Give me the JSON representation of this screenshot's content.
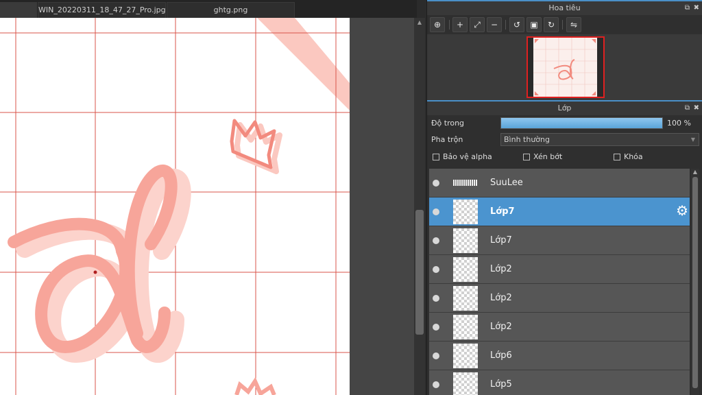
{
  "tabs": [
    {
      "label": "WIN_20220311_18_47_27_Pro.jpg"
    },
    {
      "label": "ghtg.png"
    }
  ],
  "navigator": {
    "title": "Hoa tiêu",
    "tools": [
      "zoom-actual-icon",
      "zoom-in-icon",
      "fit-screen-icon",
      "zoom-out-icon",
      "rotate-left-icon",
      "fullscreen-icon",
      "rotate-right-icon",
      "flip-icon"
    ]
  },
  "layers_panel": {
    "title": "Lớp",
    "opacity_label": "Độ trong",
    "opacity_value": "100 %",
    "opacity_fraction": 1.0,
    "blend_label": "Pha trộn",
    "blend_value": "Bình thường",
    "protect_alpha": "Bảo vệ alpha",
    "clipping": "Xén bớt",
    "lock": "Khóa",
    "layers": [
      {
        "name": "SuuLee",
        "selected": false,
        "text_thumb": true
      },
      {
        "name": "Lớp7",
        "selected": true,
        "text_thumb": false
      },
      {
        "name": "Lớp7",
        "selected": false,
        "text_thumb": false
      },
      {
        "name": "Lớp2",
        "selected": false,
        "text_thumb": false
      },
      {
        "name": "Lớp2",
        "selected": false,
        "text_thumb": false
      },
      {
        "name": "Lớp2",
        "selected": false,
        "text_thumb": false
      },
      {
        "name": "Lớp6",
        "selected": false,
        "text_thumb": false
      },
      {
        "name": "Lớp5",
        "selected": false,
        "text_thumb": false
      }
    ]
  },
  "colors": {
    "accent": "#4b94cf",
    "grid": "#d9534a",
    "stroke": "#f7a59a"
  }
}
